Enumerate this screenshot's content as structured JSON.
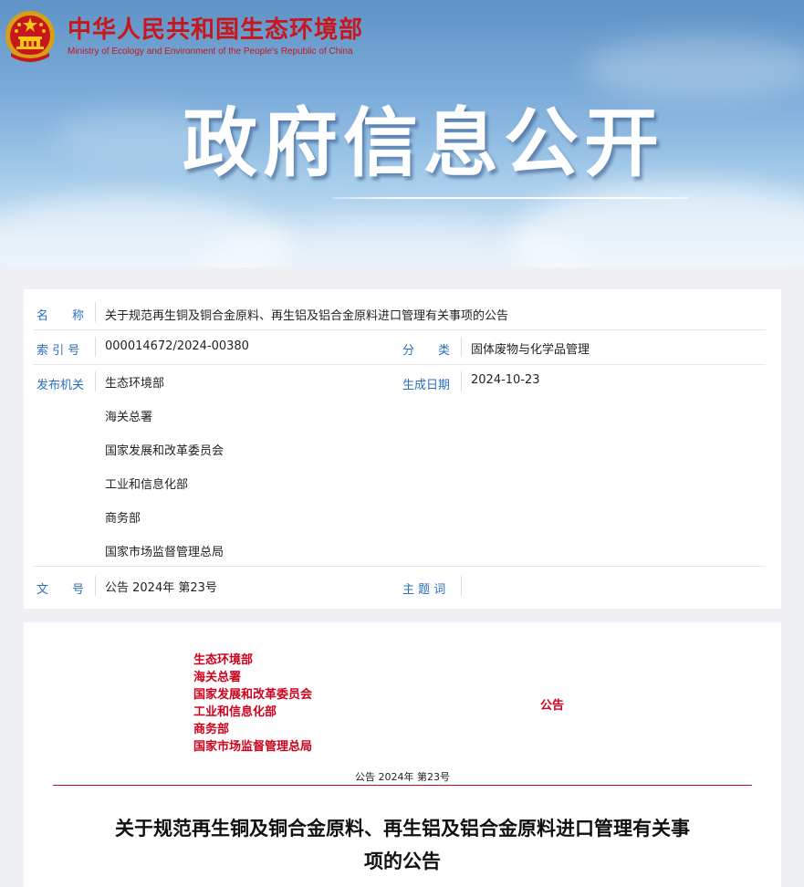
{
  "header": {
    "site_name_cn": "中华人民共和国生态环境部",
    "site_name_en": "Ministry of Ecology and Environment of the People's Republic of China",
    "banner_title": "政府信息公开"
  },
  "meta": {
    "name_label": "名　　称",
    "name_value": "关于规范再生铜及铜合金原料、再生铝及铝合金原料进口管理有关事项的公告",
    "index_label": "索 引 号",
    "index_value": "000014672/2024-00380",
    "category_label": "分　　类",
    "category_value": "固体废物与化学品管理",
    "issuer_label": "发布机关",
    "issuers": [
      "生态环境部",
      "海关总署",
      "国家发展和改革委员会",
      "工业和信息化部",
      "商务部",
      "国家市场监督管理总局"
    ],
    "date_label": "生成日期",
    "date_value": "2024-10-23",
    "docno_label": "文　　号",
    "docno_value": "公告 2024年 第23号",
    "keywords_label": "主 题 词",
    "keywords_value": ""
  },
  "document": {
    "issuers": [
      "生态环境部",
      "海关总署",
      "国家发展和改革委员会",
      "工业和信息化部",
      "商务部",
      "国家市场监督管理总局"
    ],
    "notice_word": "公告",
    "doc_number": "公告 2024年 第23号",
    "title": "关于规范再生铜及铜合金原料、再生铝及铝合金原料进口管理有关事项的公告"
  },
  "colors": {
    "brand_red": "#c8161d",
    "label_blue": "#2a6ec0",
    "doc_red": "#d0021b"
  }
}
